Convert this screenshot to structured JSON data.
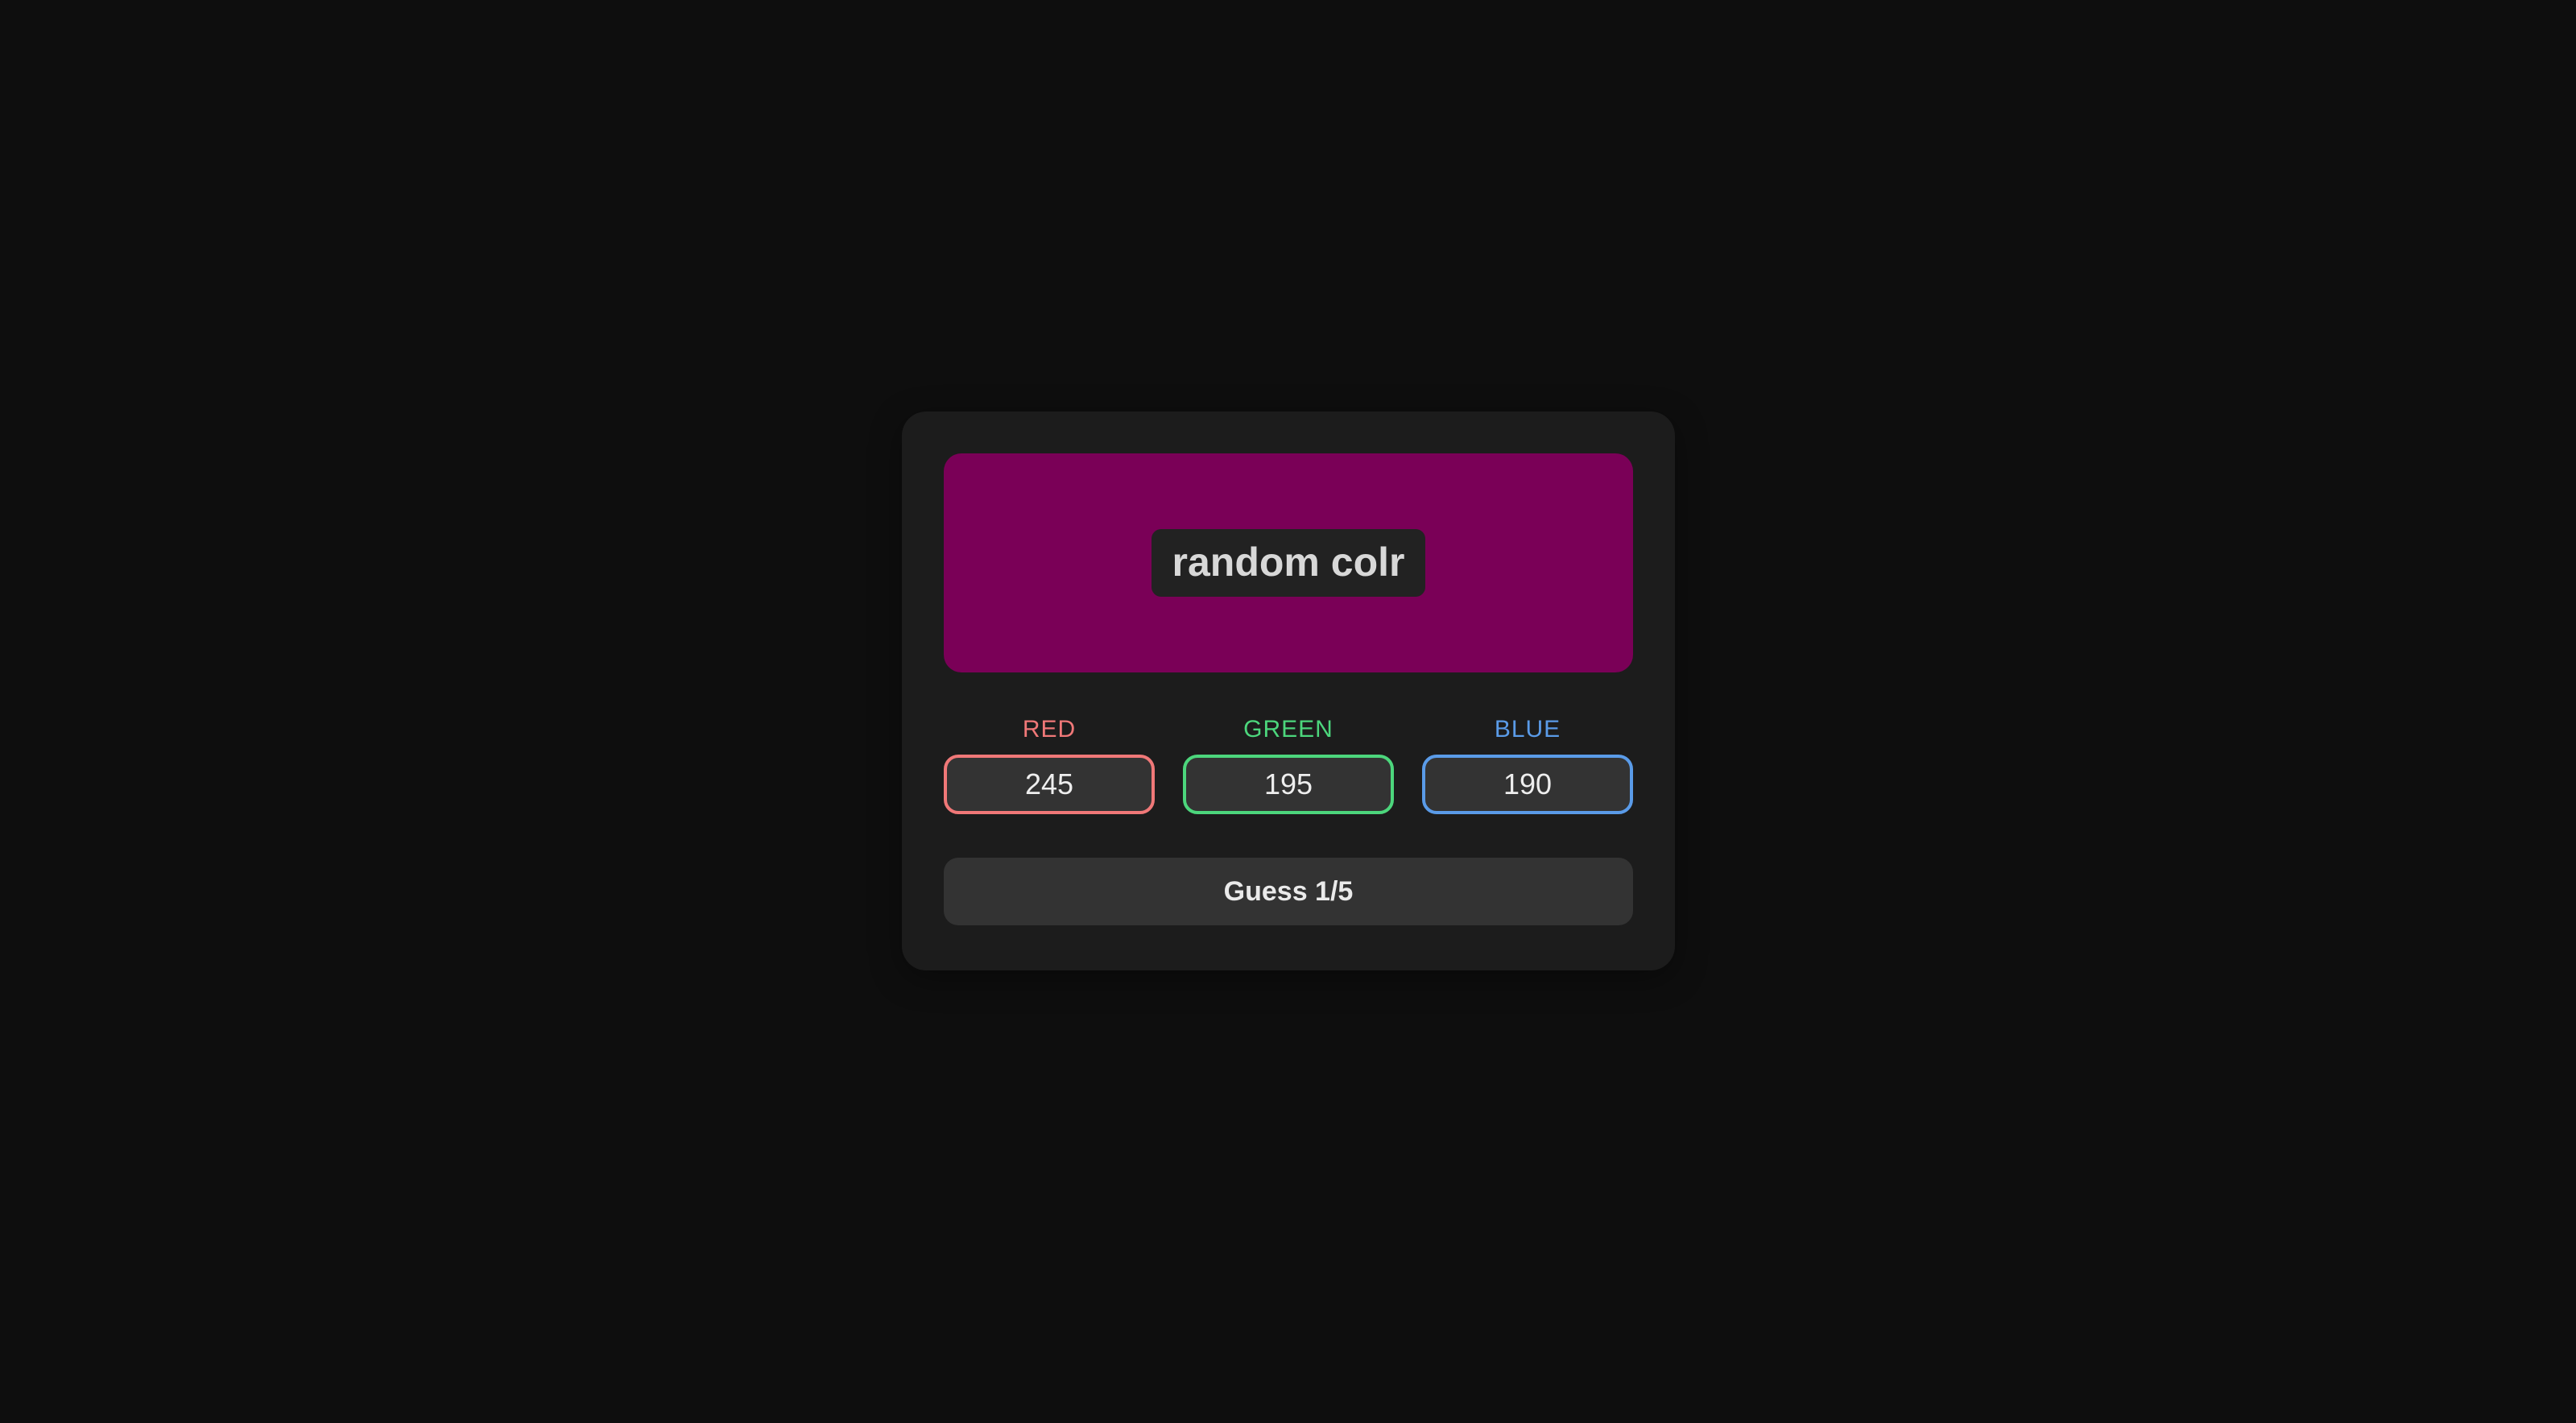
{
  "swatch": {
    "label": "random colr",
    "color": "#7a0057"
  },
  "channels": [
    {
      "label": "RED",
      "value": "245",
      "color": "#f07878"
    },
    {
      "label": "GREEN",
      "value": "195",
      "color": "#4cd67c"
    },
    {
      "label": "BLUE",
      "value": "190",
      "color": "#5a9be8"
    }
  ],
  "guess_button": {
    "label": "Guess 1/5"
  }
}
